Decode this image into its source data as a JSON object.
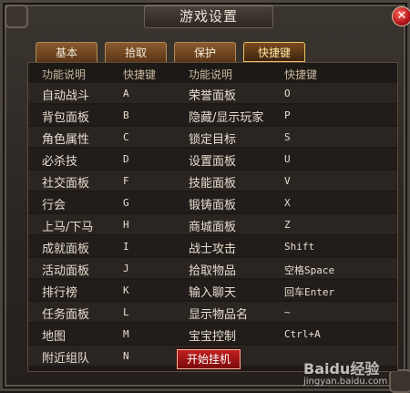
{
  "window": {
    "title": "游戏设置",
    "close_icon": "close-icon"
  },
  "tabs": [
    {
      "label": "基本",
      "active": false
    },
    {
      "label": "拾取",
      "active": false
    },
    {
      "label": "保护",
      "active": false
    },
    {
      "label": "快捷键",
      "active": true
    }
  ],
  "table": {
    "headers": {
      "func1": "功能说明",
      "key1": "快捷键",
      "func2": "功能说明",
      "key2": "快捷键"
    },
    "rows": [
      {
        "f1": "自动战斗",
        "k1": "A",
        "f2": "荣誉面板",
        "k2": "O"
      },
      {
        "f1": "背包面板",
        "k1": "B",
        "f2": "隐藏/显示玩家",
        "k2": "P"
      },
      {
        "f1": "角色属性",
        "k1": "C",
        "f2": "锁定目标",
        "k2": "S"
      },
      {
        "f1": "必杀技",
        "k1": "D",
        "f2": "设置面板",
        "k2": "U"
      },
      {
        "f1": "社交面板",
        "k1": "F",
        "f2": "技能面板",
        "k2": "V"
      },
      {
        "f1": "行会",
        "k1": "G",
        "f2": "锻铸面板",
        "k2": "X"
      },
      {
        "f1": "上马/下马",
        "k1": "H",
        "f2": "商城面板",
        "k2": "Z"
      },
      {
        "f1": "成就面板",
        "k1": "I",
        "f2": "战士攻击",
        "k2": "Shift"
      },
      {
        "f1": "活动面板",
        "k1": "J",
        "f2": "拾取物品",
        "k2": "空格Space"
      },
      {
        "f1": "排行榜",
        "k1": "K",
        "f2": "输入聊天",
        "k2": "回车Enter"
      },
      {
        "f1": "任务面板",
        "k1": "L",
        "f2": "显示物品名",
        "k2": "~"
      },
      {
        "f1": "地图",
        "k1": "M",
        "f2": "宝宝控制",
        "k2": "Ctrl+A"
      },
      {
        "f1": "附近组队",
        "k1": "N",
        "f2": "",
        "k2": ""
      }
    ]
  },
  "start_button": {
    "label": "开始挂机"
  },
  "watermark": {
    "brand": "Baidu经验",
    "url": "jingyan.baidu.com"
  }
}
